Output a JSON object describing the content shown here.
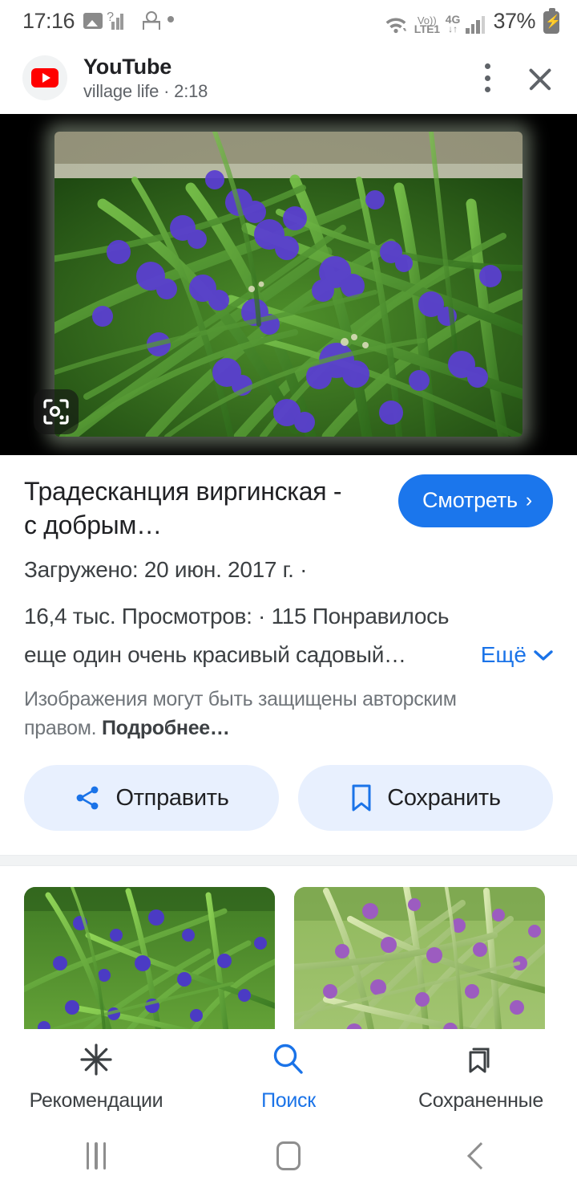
{
  "statusbar": {
    "time": "17:16",
    "icons_left": [
      "photo-icon",
      "question-signal-icon",
      "odnoklassniki-icon",
      "dot-icon"
    ],
    "wifi": "wifi-icon",
    "volte_line1": "Vo))",
    "volte_line2": "LTE1",
    "network_type": "4G",
    "network_arrows": "↓↑",
    "signal": "signal-bars-icon",
    "battery_percent": "37%",
    "battery": "battery-charging-icon"
  },
  "header": {
    "app_name": "YouTube",
    "subtitle": "village life · 2:18",
    "logo": "youtube-logo",
    "menu_icon": "kebab-menu-icon",
    "close_icon": "close-icon"
  },
  "hero": {
    "lens_icon": "google-lens-icon",
    "alt": "Tradescantia virginiana purple flowers with green leaves"
  },
  "info": {
    "title": "Традесканция виргинская - с добрым…",
    "watch_label": "Смотреть",
    "watch_chevron": "›",
    "uploaded": "Загружено: 20 июн. 2017 г.  ·",
    "stats": "16,4 тыс. Просмотров:  ·  115 Понравилось",
    "description": "еще один очень красивый садовый…",
    "more_label": "Ещё",
    "more_chevron": "chevron-down-icon",
    "copyright_text": "Изображения могут быть защищены авторским правом. ",
    "copyright_link": "Подробнее…"
  },
  "actions": {
    "share_label": "Отправить",
    "share_icon": "share-icon",
    "save_label": "Сохранить",
    "save_icon": "bookmark-icon"
  },
  "related": {
    "items": [
      {
        "name": "related-image-1",
        "alt": "Tradescantia blue flowers in garden"
      },
      {
        "name": "related-image-2",
        "alt": "Tradescantia violet flowers close up"
      }
    ]
  },
  "bottomnav": {
    "items": [
      {
        "label": "Рекомендации",
        "icon": "discover-asterisk-icon",
        "active": false
      },
      {
        "label": "Поиск",
        "icon": "search-icon",
        "active": true
      },
      {
        "label": "Сохраненные",
        "icon": "bookmarks-icon",
        "active": false
      }
    ]
  },
  "sysnav": {
    "recents": "recents-icon",
    "home": "home-icon",
    "back": "back-icon"
  },
  "colors": {
    "accent": "#1a73e8",
    "watch_button": "#1b76ec",
    "chip_bg": "#e8f0fe",
    "text_primary": "#202124",
    "text_secondary": "#3c4043",
    "text_muted": "#70757a",
    "youtube_red": "#ff0000"
  }
}
